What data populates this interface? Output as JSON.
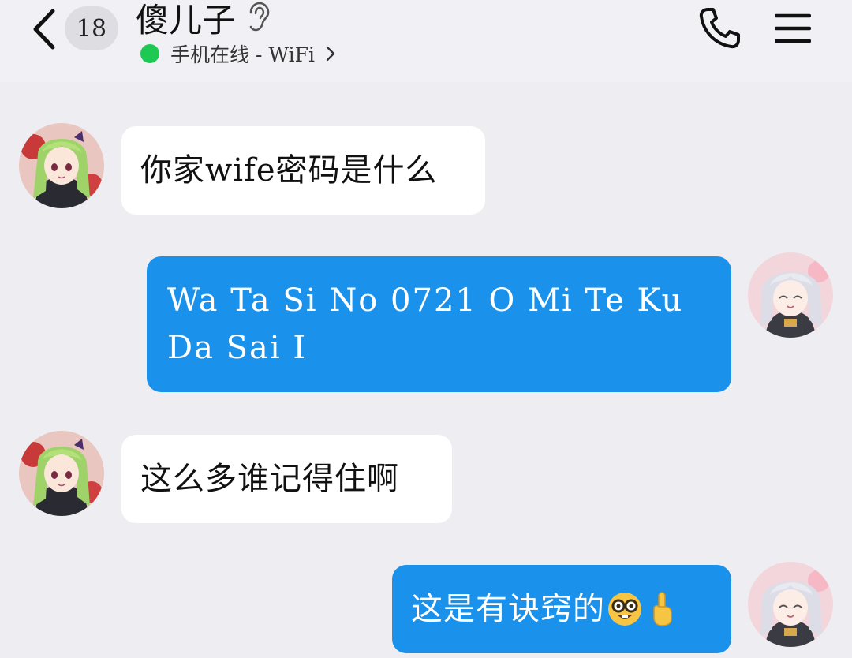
{
  "header": {
    "back_label": "<",
    "unread_count": "18",
    "title": "傻儿子",
    "status_text": "手机在线 - WiFi",
    "status_color": "#1DC853"
  },
  "icons": {
    "back": "chevron-left-icon",
    "ear": "ear-icon",
    "status_chevron": "chevron-right-icon",
    "phone": "phone-icon",
    "menu": "hamburger-menu-icon"
  },
  "colors": {
    "outgoing_bubble": "#1A91EB",
    "incoming_bubble": "#FFFFFF",
    "background": "#EDEDF2"
  },
  "messages": [
    {
      "direction": "incoming",
      "text": "你家wife密码是什么"
    },
    {
      "direction": "outgoing",
      "text_line1": "Wa Ta Si No 0721 O Mi Te Ku",
      "text_line2": "Da Sai I"
    },
    {
      "direction": "incoming",
      "text": "这么多谁记得住啊"
    },
    {
      "direction": "outgoing",
      "text": "这是有诀窍的",
      "emojis": [
        "nerd-face-emoji",
        "pointing-up-emoji"
      ]
    }
  ]
}
